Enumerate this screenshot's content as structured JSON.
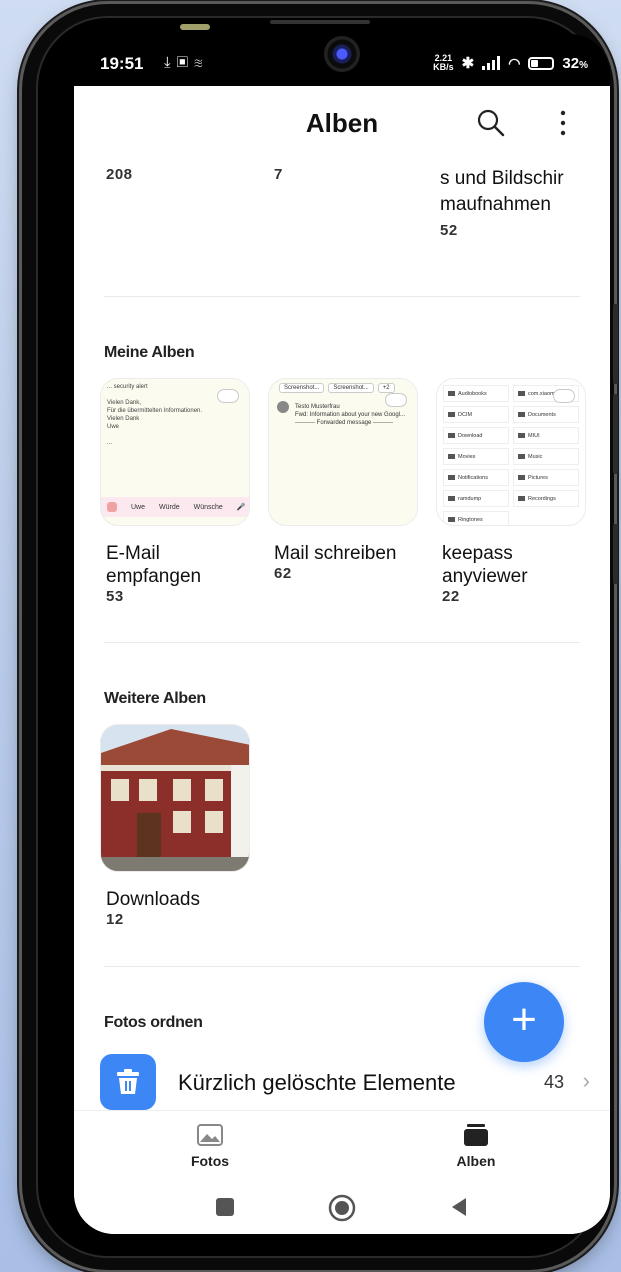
{
  "status": {
    "time": "19:51",
    "net_speed_value": "2.21",
    "net_speed_unit": "KB/s",
    "battery": "32",
    "battery_unit": "%"
  },
  "header": {
    "title": "Alben"
  },
  "previous_row": {
    "count1": "208",
    "count2": "7",
    "album3_name_line1": "s und Bildschir",
    "album3_name_line2": "maufnahmen",
    "count3": "52"
  },
  "my_albums": {
    "title": "Meine Alben",
    "items": [
      {
        "name_line1": "E-Mail",
        "name_line2": "empfangen",
        "count": "53"
      },
      {
        "name_line1": "Mail schreiben",
        "name_line2": "",
        "count": "62"
      },
      {
        "name_line1": "keepass",
        "name_line2": "anyviewer",
        "count": "22"
      }
    ]
  },
  "more_albums": {
    "title": "Weitere Alben",
    "items": [
      {
        "name": "Downloads",
        "count": "12"
      }
    ]
  },
  "organize": {
    "title": "Fotos ordnen",
    "recently_deleted": {
      "label": "Kürzlich gelöschte Elemente",
      "count": "43"
    }
  },
  "thumbs": {
    "mail1_header": "... security alert",
    "mail1_lines": [
      "Vielen Dank,",
      "Für die übermittelten Informationen.",
      "Vielen Dank",
      "Uwe"
    ],
    "mail1_dots": "...",
    "mail1_keys": [
      "Uwe",
      "Würde",
      "Wünsche"
    ],
    "mail2_tabs": [
      "Screenshot...",
      "Screenshot...",
      "+2"
    ],
    "mail2_sender": "Testo Musterfrau",
    "mail2_subject": "Fwd: Information about your new Googl...",
    "mail2_forward": "---------- Forwarded message ----------",
    "folders": [
      "Audiobooks",
      "com.xiaomi...",
      "DCIM",
      "Documents",
      "Download",
      "MIUI",
      "Movies",
      "Music",
      "Notifications",
      "Pictures",
      "ramdump",
      "Recordings",
      "Ringtones"
    ]
  },
  "bottom_nav": {
    "photos": "Fotos",
    "albums": "Alben"
  },
  "colors": {
    "accent": "#3d86f5",
    "background": "#ffffff"
  }
}
